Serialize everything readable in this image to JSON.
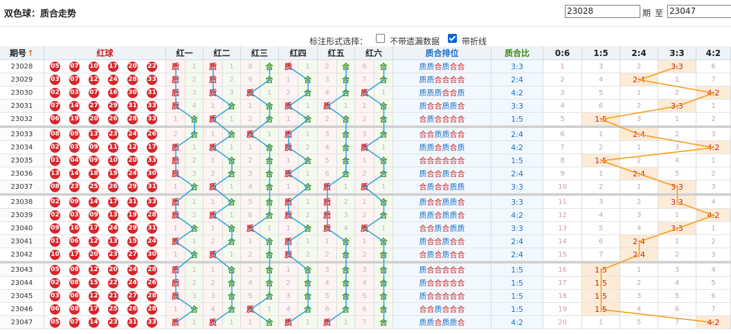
{
  "page": {
    "title": "双色球：质合走势",
    "range_start": "23028",
    "range_label_qi": "期",
    "range_label_zhi": "至",
    "range_end": "23047"
  },
  "options": {
    "label": "标注形式选择：",
    "missing_label": "不带遗漏数据",
    "missing_checked": false,
    "line_label": "带折线",
    "line_checked": true
  },
  "headers": {
    "period": "期号",
    "sort_icon": "sort-up-icon",
    "balls": "红球",
    "positions": [
      "红一",
      "红二",
      "红三",
      "红四",
      "红五",
      "红六"
    ],
    "arrange": "质合排位",
    "ratio": "质合比",
    "dist": [
      "0:6",
      "1:5",
      "2:4",
      "3:3",
      "4:2"
    ]
  },
  "colors": {
    "ball": "#d6262b",
    "prime": "#c81d1d",
    "composite": "#3d8a16",
    "line_pos": "#33a3dc",
    "line_ratio": "#f39c19"
  },
  "rows": [
    {
      "period": "23028",
      "balls": [
        "05",
        "07",
        "10",
        "17",
        "20",
        "22"
      ],
      "pos": [
        [
          "质",
          "1"
        ],
        [
          "质",
          "1"
        ],
        [
          "8",
          "合"
        ],
        [
          "质",
          "1"
        ],
        [
          "2",
          "合"
        ],
        [
          "6",
          "合"
        ]
      ],
      "arrange": "质质合质合合",
      "ratio": "3:3",
      "dist": [
        "1",
        "3",
        "2",
        "3:3",
        "6"
      ]
    },
    {
      "period": "23029",
      "balls": [
        "03",
        "07",
        "12",
        "24",
        "28",
        "33"
      ],
      "pos": [
        [
          "质",
          "2"
        ],
        [
          "质",
          "2"
        ],
        [
          "9",
          "合"
        ],
        [
          "1",
          "合"
        ],
        [
          "3",
          "合"
        ],
        [
          "7",
          "合"
        ]
      ],
      "arrange": "质质合合合合",
      "ratio": "2:4",
      "dist": [
        "2",
        "4",
        "2:4",
        "1",
        "7"
      ]
    },
    {
      "period": "23030",
      "balls": [
        "02",
        "03",
        "07",
        "16",
        "30",
        "31"
      ],
      "pos": [
        [
          "质",
          "3"
        ],
        [
          "质",
          "3"
        ],
        [
          "质",
          "1"
        ],
        [
          "2",
          "合"
        ],
        [
          "4",
          "合"
        ],
        [
          "质",
          "1"
        ]
      ],
      "arrange": "质质质合合质",
      "ratio": "4:2",
      "dist": [
        "3",
        "5",
        "1",
        "2",
        "4:2"
      ]
    },
    {
      "period": "23031",
      "balls": [
        "07",
        "14",
        "27",
        "29",
        "31",
        "33"
      ],
      "pos": [
        [
          "质",
          "4"
        ],
        [
          "1",
          "合"
        ],
        [
          "1",
          "合"
        ],
        [
          "质",
          "1"
        ],
        [
          "质",
          "1"
        ],
        [
          "1",
          "合"
        ]
      ],
      "arrange": "质合合质质合",
      "ratio": "3:3",
      "dist": [
        "4",
        "6",
        "2",
        "3:3",
        "1"
      ]
    },
    {
      "period": "23032",
      "balls": [
        "06",
        "19",
        "20",
        "26",
        "28",
        "33"
      ],
      "pos": [
        [
          "1",
          "合"
        ],
        [
          "质",
          "1"
        ],
        [
          "2",
          "合"
        ],
        [
          "1",
          "合"
        ],
        [
          "2",
          "合"
        ],
        [
          "2",
          "合"
        ]
      ],
      "arrange": "合质合合合合",
      "ratio": "1:5",
      "dist": [
        "5",
        "1:5",
        "3",
        "1",
        "2"
      ]
    },
    {
      "period": "23033",
      "balls": [
        "08",
        "09",
        "13",
        "23",
        "24",
        "26"
      ],
      "pos": [
        [
          "2",
          "合"
        ],
        [
          "1",
          "合"
        ],
        [
          "质",
          "1"
        ],
        [
          "质",
          "1"
        ],
        [
          "3",
          "合"
        ],
        [
          "3",
          "合"
        ]
      ],
      "arrange": "合合质质合合",
      "ratio": "2:4",
      "dist": [
        "6",
        "1",
        "2:4",
        "2",
        "3"
      ]
    },
    {
      "period": "23034",
      "balls": [
        "02",
        "03",
        "09",
        "11",
        "12",
        "17"
      ],
      "pos": [
        [
          "质",
          "1"
        ],
        [
          "质",
          "1"
        ],
        [
          "1",
          "合"
        ],
        [
          "质",
          "2"
        ],
        [
          "4",
          "合"
        ],
        [
          "质",
          "1"
        ]
      ],
      "arrange": "质质合质合质",
      "ratio": "4:2",
      "dist": [
        "7",
        "2",
        "1",
        "3",
        "4:2"
      ]
    },
    {
      "period": "23035",
      "balls": [
        "01",
        "04",
        "09",
        "10",
        "20",
        "33"
      ],
      "pos": [
        [
          "质",
          "2"
        ],
        [
          "1",
          "合"
        ],
        [
          "2",
          "合"
        ],
        [
          "1",
          "合"
        ],
        [
          "5",
          "合"
        ],
        [
          "1",
          "合"
        ]
      ],
      "arrange": "合合合合合合",
      "ratio": "1:5",
      "dist": [
        "8",
        "1:5",
        "2",
        "4",
        "1"
      ]
    },
    {
      "period": "23036",
      "balls": [
        "13",
        "14",
        "18",
        "19",
        "24",
        "30"
      ],
      "pos": [
        [
          "质",
          "3"
        ],
        [
          "2",
          "合"
        ],
        [
          "3",
          "合"
        ],
        [
          "质",
          "1"
        ],
        [
          "6",
          "合"
        ],
        [
          "2",
          "合"
        ]
      ],
      "arrange": "质合合质合合",
      "ratio": "2:4",
      "dist": [
        "9",
        "1",
        "2:4",
        "5",
        "2"
      ]
    },
    {
      "period": "23037",
      "balls": [
        "08",
        "23",
        "25",
        "26",
        "29",
        "31"
      ],
      "pos": [
        [
          "1",
          "合"
        ],
        [
          "质",
          "1"
        ],
        [
          "4",
          "合"
        ],
        [
          "1",
          "合"
        ],
        [
          "质",
          "1"
        ],
        [
          "质",
          "1"
        ]
      ],
      "arrange": "合质合合质质",
      "ratio": "3:3",
      "dist": [
        "10",
        "2",
        "1",
        "3:3",
        "3"
      ]
    },
    {
      "period": "23038",
      "balls": [
        "02",
        "09",
        "14",
        "17",
        "31",
        "33"
      ],
      "pos": [
        [
          "质",
          "1"
        ],
        [
          "1",
          "合"
        ],
        [
          "5",
          "合"
        ],
        [
          "质",
          "1"
        ],
        [
          "质",
          "2"
        ],
        [
          "1",
          "合"
        ]
      ],
      "arrange": "质合合质质合",
      "ratio": "3:3",
      "dist": [
        "11",
        "3",
        "2",
        "3:3",
        "4"
      ]
    },
    {
      "period": "23039",
      "balls": [
        "02",
        "03",
        "09",
        "13",
        "19",
        "28"
      ],
      "pos": [
        [
          "质",
          "2"
        ],
        [
          "质",
          "1"
        ],
        [
          "6",
          "合"
        ],
        [
          "质",
          "2"
        ],
        [
          "质",
          "3"
        ],
        [
          "2",
          "合"
        ]
      ],
      "arrange": "质质合质质合",
      "ratio": "4:2",
      "dist": [
        "12",
        "4",
        "3",
        "1",
        "4:2"
      ]
    },
    {
      "period": "23040",
      "balls": [
        "09",
        "16",
        "17",
        "24",
        "29",
        "31"
      ],
      "pos": [
        [
          "1",
          "合"
        ],
        [
          "1",
          "合"
        ],
        [
          "质",
          "1"
        ],
        [
          "1",
          "合"
        ],
        [
          "质",
          "4"
        ],
        [
          "质",
          "1"
        ]
      ],
      "arrange": "合合质合质质",
      "ratio": "3:3",
      "dist": [
        "13",
        "5",
        "4",
        "3:3",
        "1"
      ]
    },
    {
      "period": "23041",
      "balls": [
        "01",
        "06",
        "12",
        "13",
        "15",
        "24"
      ],
      "pos": [
        [
          "质",
          "1"
        ],
        [
          "2",
          "合"
        ],
        [
          "1",
          "合"
        ],
        [
          "质",
          "1"
        ],
        [
          "1",
          "合"
        ],
        [
          "1",
          "合"
        ]
      ],
      "arrange": "质合合质合合",
      "ratio": "2:4",
      "dist": [
        "14",
        "6",
        "2:4",
        "1",
        "2"
      ]
    },
    {
      "period": "23042",
      "balls": [
        "10",
        "17",
        "20",
        "23",
        "27",
        "30"
      ],
      "pos": [
        [
          "1",
          "合"
        ],
        [
          "质",
          "1"
        ],
        [
          "2",
          "合"
        ],
        [
          "质",
          "2"
        ],
        [
          "2",
          "合"
        ],
        [
          "2",
          "合"
        ]
      ],
      "arrange": "合质合质合合",
      "ratio": "2:4",
      "dist": [
        "15",
        "7",
        "2:4",
        "2",
        "3"
      ]
    },
    {
      "period": "23043",
      "balls": [
        "05",
        "08",
        "12",
        "20",
        "24",
        "28"
      ],
      "pos": [
        [
          "质",
          "1"
        ],
        [
          "1",
          "合"
        ],
        [
          "3",
          "合"
        ],
        [
          "1",
          "合"
        ],
        [
          "3",
          "合"
        ],
        [
          "3",
          "合"
        ]
      ],
      "arrange": "质合合合合合",
      "ratio": "1:5",
      "dist": [
        "16",
        "1:5",
        "1",
        "3",
        "4"
      ]
    },
    {
      "period": "23044",
      "balls": [
        "02",
        "08",
        "15",
        "22",
        "24",
        "26"
      ],
      "pos": [
        [
          "质",
          "2"
        ],
        [
          "2",
          "合"
        ],
        [
          "4",
          "合"
        ],
        [
          "2",
          "合"
        ],
        [
          "4",
          "合"
        ],
        [
          "4",
          "合"
        ]
      ],
      "arrange": "质合合合合合",
      "ratio": "1:5",
      "dist": [
        "17",
        "1:5",
        "2",
        "4",
        "5"
      ]
    },
    {
      "period": "23045",
      "balls": [
        "03",
        "06",
        "12",
        "21",
        "27",
        "28"
      ],
      "pos": [
        [
          "质",
          "3"
        ],
        [
          "3",
          "合"
        ],
        [
          "5",
          "合"
        ],
        [
          "3",
          "合"
        ],
        [
          "5",
          "合"
        ],
        [
          "5",
          "合"
        ]
      ],
      "arrange": "质合合合合合",
      "ratio": "1:5",
      "dist": [
        "18",
        "1:5",
        "3",
        "5",
        "6"
      ]
    },
    {
      "period": "23046",
      "balls": [
        "06",
        "08",
        "17",
        "25",
        "26",
        "28"
      ],
      "pos": [
        [
          "1",
          "合"
        ],
        [
          "4",
          "合"
        ],
        [
          "质",
          "1"
        ],
        [
          "4",
          "合"
        ],
        [
          "6",
          "合"
        ],
        [
          "6",
          "合"
        ]
      ],
      "arrange": "合合质合合合",
      "ratio": "1:5",
      "dist": [
        "19",
        "1:5",
        "4",
        "6",
        "7"
      ]
    },
    {
      "period": "23047",
      "balls": [
        "05",
        "07",
        "14",
        "23",
        "31",
        "33"
      ],
      "pos": [
        [
          "质",
          "1"
        ],
        [
          "质",
          "1"
        ],
        [
          "1",
          "合"
        ],
        [
          "质",
          "1"
        ],
        [
          "质",
          "1"
        ],
        [
          "7",
          "合"
        ]
      ],
      "arrange": "质质合质质合",
      "ratio": "4:2",
      "dist": [
        "20",
        "1",
        "5",
        "7",
        "4:2"
      ]
    }
  ]
}
